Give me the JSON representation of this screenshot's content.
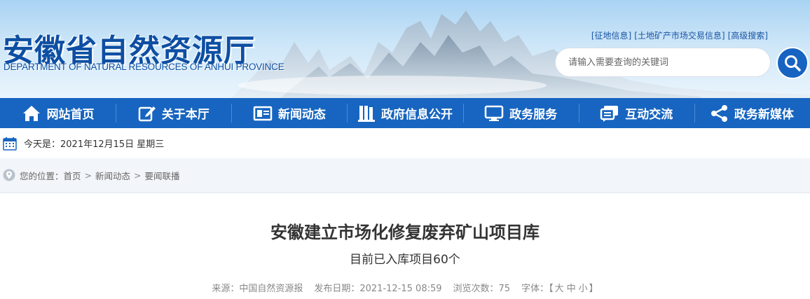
{
  "site": {
    "name_cn": "安徽省自然资源厅",
    "name_en": "DEPARTMENT OF NATURAL RESOURCES OF ANHUI PROVINCE"
  },
  "top_links": [
    {
      "label": "[征地信息]"
    },
    {
      "label": "[土地矿产市场交易信息]"
    },
    {
      "label": "[高级搜索]"
    }
  ],
  "search": {
    "placeholder": "请输入需要查询的关键词",
    "icon": "search-icon"
  },
  "nav": [
    {
      "label": "网站首页",
      "icon": "home-icon"
    },
    {
      "label": "关于本厅",
      "icon": "edit-icon"
    },
    {
      "label": "新闻动态",
      "icon": "news-icon"
    },
    {
      "label": "政府信息公开",
      "icon": "book-icon"
    },
    {
      "label": "政务服务",
      "icon": "monitor-icon"
    },
    {
      "label": "互动交流",
      "icon": "chat-icon"
    },
    {
      "label": "政务新媒体",
      "icon": "share-icon"
    }
  ],
  "date_bar": {
    "text": "今天是：2021年12月15日 星期三",
    "icon": "calendar-icon"
  },
  "breadcrumb": {
    "prefix": "您的位置：",
    "items": [
      "首页",
      "新闻动态",
      "要闻联播"
    ],
    "separator": ">",
    "icon": "location-pin-icon"
  },
  "article": {
    "title": "安徽建立市场化修复废弃矿山项目库",
    "subtitle": "目前已入库项目60个",
    "source": "来源：中国自然资源报",
    "publish_date": "发布日期：2021-12-15 08:59",
    "views": "浏览次数：75",
    "font_size_label": "字体：【",
    "font_sizes": [
      "大",
      "中",
      "小"
    ],
    "font_size_close": "】"
  },
  "colors": {
    "nav_bg": "#1765c0",
    "brand_blue": "#0d4fa3",
    "page_bg": "#f2f5f9"
  }
}
